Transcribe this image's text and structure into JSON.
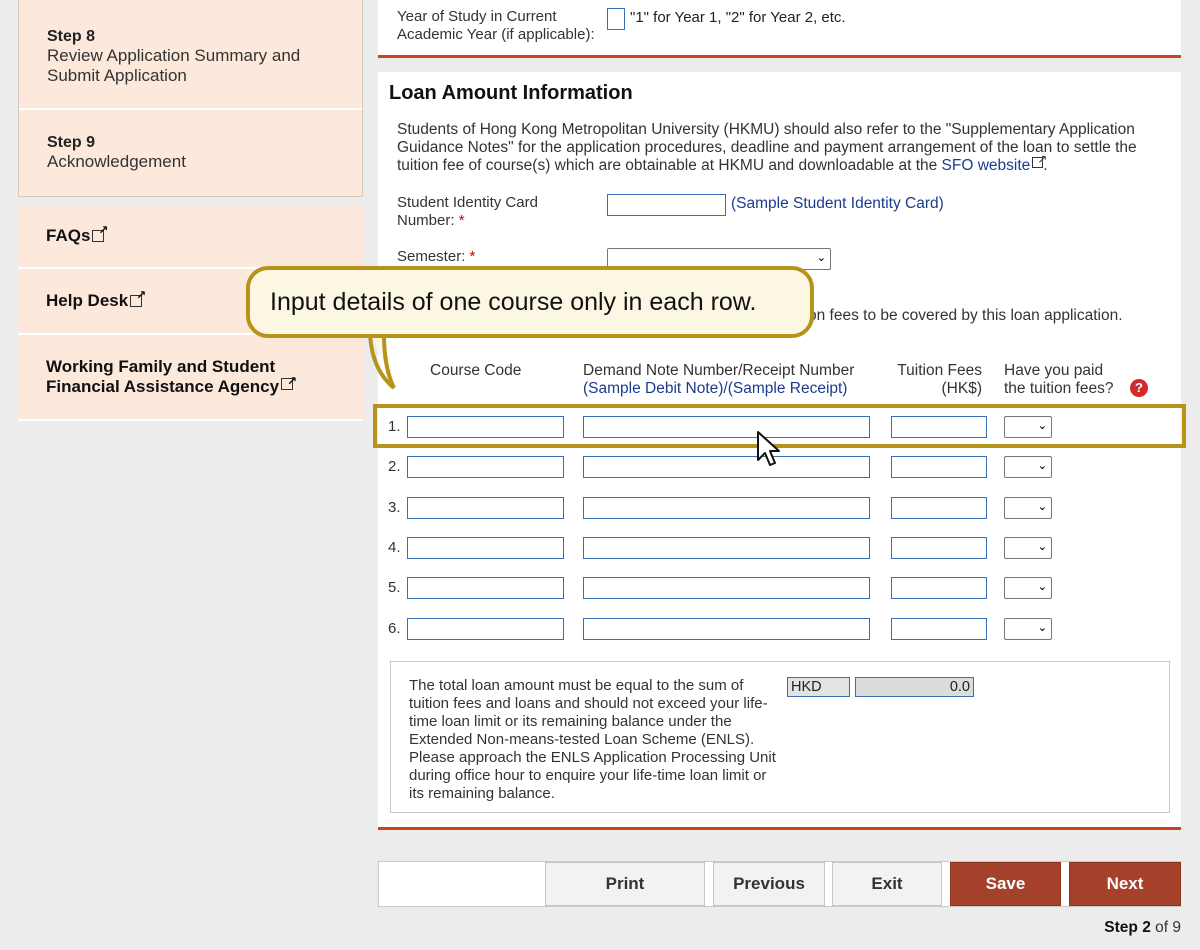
{
  "sidebar": {
    "steps": [
      {
        "num": "Step 8",
        "desc": "Review Application Summary and Submit Application"
      },
      {
        "num": "Step 9",
        "desc": "Acknowledgement"
      }
    ],
    "links": [
      {
        "label": "FAQs"
      },
      {
        "label": "Help Desk"
      },
      {
        "label": "Working Family and Student Financial Assistance Agency"
      }
    ]
  },
  "top": {
    "year_label": "Year of Study in Current Academic Year (if applicable):",
    "year_hint": "\"1\" for Year 1, \"2\" for Year 2, etc.",
    "year_value": ""
  },
  "loan": {
    "title": "Loan Amount Information",
    "intro_prefix": "Students of Hong Kong Metropolitan University (HKMU) should also refer to the \"Supplementary Application Guidance Notes\" for the application procedures, deadline and payment arrangement of the loan to settle the tuition fee of course(s) which are obtainable at HKMU and downloadable at the ",
    "intro_link": "SFO website",
    "intro_suffix": ".",
    "sid_label": "Student Identity Card Number:",
    "sid_required": "*",
    "sid_value": "",
    "sid_sample": "(Sample Student Identity Card)",
    "semester_label": "Semester:",
    "semester_required": "*",
    "semester_value": "",
    "covered_partial": "on fees to be covered by this loan application.",
    "columns": {
      "course_code": "Course Code",
      "demand_note": "Demand Note Number/Receipt Number",
      "sample_debit": "(Sample Debit Note)",
      "slash": "/",
      "sample_receipt": "(Sample Receipt)",
      "tuition_fees": "Tuition Fees",
      "hk_dollar": "(HK$)",
      "paid_q1": "Have you paid",
      "paid_q2": "the tuition fees?",
      "help": "?"
    },
    "rows": [
      {
        "num": "1.",
        "course": "",
        "note": "",
        "fee": "",
        "paid": ""
      },
      {
        "num": "2.",
        "course": "",
        "note": "",
        "fee": "",
        "paid": ""
      },
      {
        "num": "3.",
        "course": "",
        "note": "",
        "fee": "",
        "paid": ""
      },
      {
        "num": "4.",
        "course": "",
        "note": "",
        "fee": "",
        "paid": ""
      },
      {
        "num": "5.",
        "course": "",
        "note": "",
        "fee": "",
        "paid": ""
      },
      {
        "num": "6.",
        "course": "",
        "note": "",
        "fee": "",
        "paid": ""
      }
    ],
    "total_text": "The total loan amount must be equal to the sum of tuition fees and loans and should not exceed your life-time loan limit or its remaining balance under the Extended Non-means-tested Loan Scheme (ENLS). Please approach the ENLS Application Processing Unit during office hour to enquire your life-time loan limit or its remaining balance.",
    "currency": "HKD",
    "total_amount": "0.0"
  },
  "buttons": {
    "print": "Print",
    "previous": "Previous",
    "exit": "Exit",
    "save": "Save",
    "next": "Next"
  },
  "step_indicator": {
    "prefix": "Step",
    "current": "2",
    "of": "of",
    "total": "9"
  },
  "callout": {
    "text": "Input details of one course only in each row."
  },
  "colors": {
    "accent_red": "#a5402a",
    "rule_orange": "#c9431f",
    "callout_gold": "#b8931a",
    "sidebar_peach": "#fde9dc",
    "link_blue": "#1a3c8f"
  }
}
